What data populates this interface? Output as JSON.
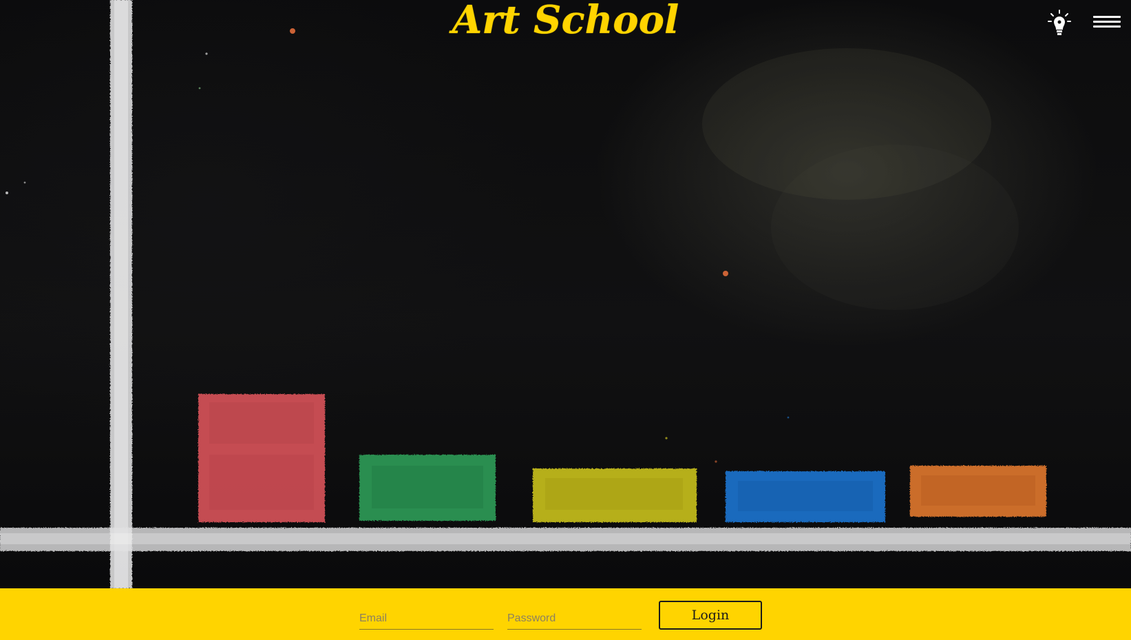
{
  "header": {
    "title": "Art School",
    "title_color": "#ffd400",
    "bulb_icon": "lightbulb-icon",
    "menu_icon": "hamburger-menu-icon"
  },
  "hero": {
    "background": "chalkboard",
    "chalk_bars": [
      {
        "color": "#d9535a",
        "name": "red"
      },
      {
        "color": "#2e9d58",
        "name": "green"
      },
      {
        "color": "#c9c11f",
        "name": "yellow"
      },
      {
        "color": "#1f74d1",
        "name": "blue"
      },
      {
        "color": "#e0782e",
        "name": "orange"
      }
    ]
  },
  "login": {
    "email_placeholder": "Email",
    "password_placeholder": "Password",
    "login_label": "Login",
    "bar_color": "#ffd400"
  }
}
